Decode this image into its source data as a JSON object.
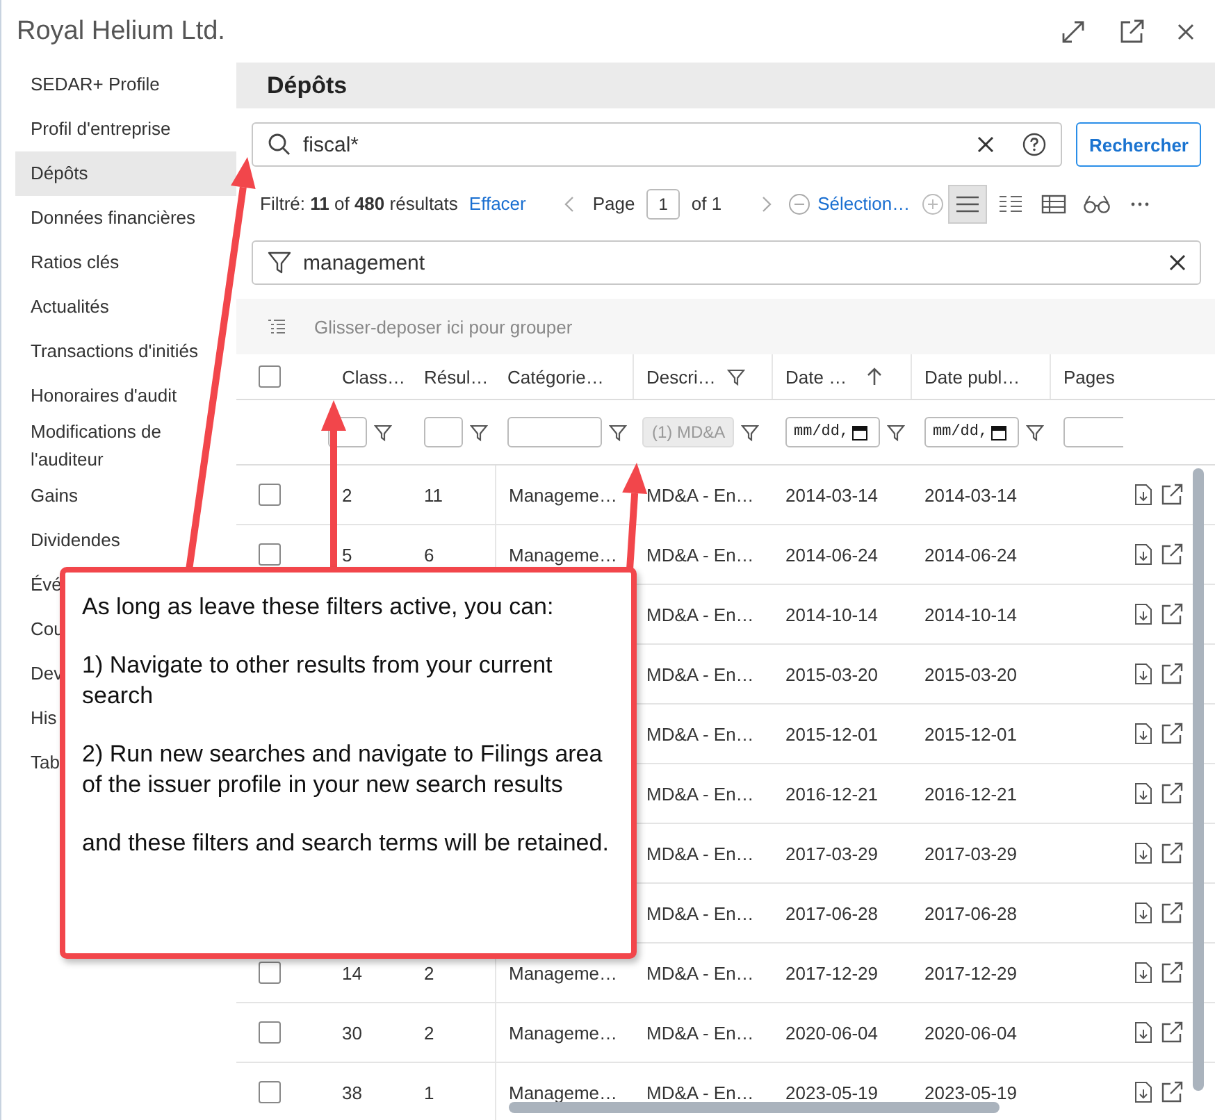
{
  "window": {
    "title": "Royal Helium Ltd."
  },
  "sidebar": {
    "items": [
      {
        "label": "SEDAR+ Profile",
        "selected": false
      },
      {
        "label": "Profil d'entreprise",
        "selected": false
      },
      {
        "label": "Dépôts",
        "selected": true
      },
      {
        "label": "Données financières",
        "selected": false
      },
      {
        "label": "Ratios clés",
        "selected": false
      },
      {
        "label": "Actualités",
        "selected": false
      },
      {
        "label": "Transactions d'initiés",
        "selected": false
      },
      {
        "label": "Honoraires d'audit",
        "selected": false
      },
      {
        "label": "Modifications de l'auditeur",
        "selected": false
      },
      {
        "label": "Gains",
        "selected": false
      },
      {
        "label": "Dividendes",
        "selected": false
      },
      {
        "label": "Évé",
        "selected": false
      },
      {
        "label": "Cou",
        "selected": false
      },
      {
        "label": "Dev",
        "selected": false
      },
      {
        "label": "His",
        "selected": false
      },
      {
        "label": "Tab",
        "selected": false
      }
    ]
  },
  "main": {
    "title": "Dépôts"
  },
  "search": {
    "value": "fiscal*",
    "button": "Rechercher"
  },
  "summary": {
    "text": "Filtré: **11** of **480** résultats",
    "clear": "Effacer"
  },
  "pager": {
    "label": "Page",
    "page": "1",
    "of": "of 1"
  },
  "selection": {
    "label": "Sélection…"
  },
  "views": [
    {
      "kind": "list",
      "selected": true
    },
    {
      "kind": "compact",
      "selected": false
    },
    {
      "kind": "table",
      "selected": false
    },
    {
      "kind": "glasses",
      "selected": false
    },
    {
      "kind": "more",
      "selected": false
    }
  ],
  "filter": {
    "value": "management"
  },
  "group_panel": {
    "text": "Glisser-deposer ici pour grouper"
  },
  "table": {
    "columns": [
      {
        "label": "Class…",
        "filtered": false,
        "sorted": false
      },
      {
        "label": "Résul…",
        "filtered": false,
        "sorted": false
      },
      {
        "label": "Catégorie…",
        "filtered": false,
        "sorted": false
      },
      {
        "label": "Descri…",
        "filtered": true,
        "sorted": false
      },
      {
        "label": "Date …",
        "filtered": false,
        "sorted": true
      },
      {
        "label": "Date publ…",
        "filtered": false,
        "sorted": false
      },
      {
        "label": "Pages",
        "filtered": false,
        "sorted": false
      }
    ],
    "all_checked": false,
    "column_filters": [
      {
        "kind": "text"
      },
      {
        "kind": "text"
      },
      {
        "kind": "text"
      },
      {
        "kind": "select",
        "value": "(1) MD&A"
      },
      {
        "kind": "date",
        "placeholder": "mm/dd,"
      },
      {
        "kind": "date",
        "placeholder": "mm/dd,"
      },
      {
        "kind": "text"
      }
    ],
    "rows": [
      {
        "checked": false,
        "class": "2",
        "results": "11",
        "category": "Manageme…",
        "description": "MD&A - En…",
        "date": "2014-03-14",
        "published": "2014-03-14"
      },
      {
        "checked": false,
        "class": "5",
        "results": "6",
        "category": "Manageme…",
        "description": "MD&A - En…",
        "date": "2014-06-24",
        "published": "2014-06-24"
      },
      {
        "description": "MD&A - En…",
        "date": "2014-10-14",
        "published": "2014-10-14"
      },
      {
        "description": "MD&A - En…",
        "date": "2015-03-20",
        "published": "2015-03-20"
      },
      {
        "description": "MD&A - En…",
        "date": "2015-12-01",
        "published": "2015-12-01"
      },
      {
        "description": "MD&A - En…",
        "date": "2016-12-21",
        "published": "2016-12-21"
      },
      {
        "description": "MD&A - En…",
        "date": "2017-03-29",
        "published": "2017-03-29"
      },
      {
        "description": "MD&A - En…",
        "date": "2017-06-28",
        "published": "2017-06-28"
      },
      {
        "checked": false,
        "class": "14",
        "results": "2",
        "category": "Manageme…",
        "description": "MD&A - En…",
        "date": "2017-12-29",
        "published": "2017-12-29"
      },
      {
        "checked": false,
        "class": "30",
        "results": "2",
        "category": "Manageme…",
        "description": "MD&A - En…",
        "date": "2020-06-04",
        "published": "2020-06-04"
      },
      {
        "checked": false,
        "class": "38",
        "results": "1",
        "category": "Manageme…",
        "description": "MD&A - En…",
        "date": "2023-05-19",
        "published": "2023-05-19"
      }
    ]
  },
  "callout": {
    "paragraphs": [
      "As long as leave these filters active, you can:",
      "1) Navigate to other results from your current search",
      "2) Run new searches and navigate to Filings area of the issuer profile in your new search results",
      "and these filters and search terms will be retained."
    ]
  }
}
